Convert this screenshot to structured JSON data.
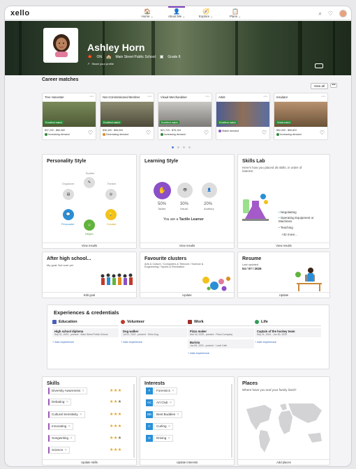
{
  "nav": {
    "logo": "xello",
    "items": [
      {
        "label": "Home",
        "icon": "house-icon"
      },
      {
        "label": "About Me",
        "icon": "person-icon"
      },
      {
        "label": "Explore",
        "icon": "compass-icon"
      },
      {
        "label": "Plans",
        "icon": "clipboard-icon"
      }
    ],
    "chevron": "⌄"
  },
  "profile": {
    "name": "Ashley Horn",
    "province": "ON",
    "school": "Main Street Public School",
    "grade": "Grade 8",
    "share_label": "Share your profile"
  },
  "career": {
    "title": "Career matches",
    "view_all": "View all",
    "more": "•••",
    "cards": [
      {
        "title": "Tree Harvester",
        "badge": "Excellent match",
        "salary": "$37,232 - $60,082",
        "demand": "Increasing demand",
        "demand_color": "#2f8a3a",
        "img": "#6b7d4b"
      },
      {
        "title": "Non-Commissioned Member",
        "badge": "Excellent match",
        "salary": "$36,300 - $96,000",
        "demand": "Decreasing demand",
        "demand_color": "#e08a1e",
        "img": "#6c6a55"
      },
      {
        "title": "Visual Merchandiser",
        "badge": "Excellent match",
        "salary": "$21,720 - $75,104",
        "demand": "Increasing demand",
        "demand_color": "#2f8a3a",
        "img": "#a8a7a5"
      },
      {
        "title": "Artist",
        "badge": "Excellent match",
        "salary": "",
        "demand": "Stable demand",
        "demand_color": "#8a55c8",
        "img": "#5a6ea3"
      },
      {
        "title": "Insulator",
        "badge": "Great match",
        "salary": "$52,000 - $90,822",
        "demand": "Increasing demand",
        "demand_color": "#2f8a3a",
        "img": "#9e7a59"
      }
    ]
  },
  "personality": {
    "title": "Personality Style",
    "traits": [
      "Builder",
      "Organizer",
      "Thinker",
      "Persuader",
      "Creator",
      "Helper"
    ],
    "footer": "View results"
  },
  "learning": {
    "title": "Learning Style",
    "styles": [
      {
        "pct": "50%",
        "name": "Tactile"
      },
      {
        "pct": "30%",
        "name": "Visual"
      },
      {
        "pct": "20%",
        "name": "Auditory"
      }
    ],
    "prefix": "You are a ",
    "result": "Tactile Learner",
    "footer": "View results"
  },
  "skills_lab": {
    "title": "Skills Lab",
    "subtitle": "Here's how you placed 35 skills, in order of interest:",
    "items": [
      "Negotiating",
      "Operating Equipment or Machines",
      "Teaching"
    ],
    "more": "+32 more...",
    "footer": "View results"
  },
  "after_hs": {
    "title": "After high school...",
    "subtitle": "My goal: Not sure yet",
    "footer": "Edit goal"
  },
  "clusters": {
    "title": "Favourite clusters",
    "text": "Arts & Culture  /  Computers & Telecom  /  Science & Engineering  /  Sports & Recreation",
    "footer": "Update"
  },
  "resume": {
    "title": "Resume",
    "last_label": "Last updated",
    "last_date": "04 / 07 / 2026",
    "footer": "Update"
  },
  "experiences": {
    "title": "Experiences & credentials",
    "columns": [
      {
        "name": "Education",
        "color": "#4b5fb8",
        "items": [
          {
            "a": "High school diploma",
            "b": "Sep 01, 2023 - present · Main Street Public School"
          }
        ],
        "add": "+ Add experience"
      },
      {
        "name": "Volunteer",
        "color": "#c0392b",
        "items": [
          {
            "a": "Dog walker",
            "b": "Jul 01, 2022 - present · Shiro Dog"
          }
        ],
        "add": "+ Add experience"
      },
      {
        "name": "Work",
        "color": "#a0302a",
        "items": [
          {
            "a": "Pizza maker",
            "b": "Mar 18, 2025 - present · Pizza Company"
          },
          {
            "a": "Barista",
            "b": "Jun 05, 2024 - present · Local Cafe"
          }
        ],
        "add": "+ Add experience"
      },
      {
        "name": "Life",
        "color": "#2f9e55",
        "items": [
          {
            "a": "Captain of the hockey team",
            "b": "Sep 01, 2024 - Jun 30, 2025"
          }
        ],
        "add": "+ Add experience"
      }
    ]
  },
  "skills": {
    "title": "Skills",
    "items": [
      {
        "name": "Diversity Awareness",
        "stars": 3
      },
      {
        "name": "Debating",
        "stars": 2
      },
      {
        "name": "Cultural Sensitivity",
        "stars": 3
      },
      {
        "name": "Innovating",
        "stars": 3
      },
      {
        "name": "Songwriting",
        "stars": 2
      },
      {
        "name": "Science",
        "stars": 3
      }
    ],
    "footer": "Update skills"
  },
  "interests": {
    "title": "Interests",
    "items": [
      {
        "code": "F",
        "name": "Forensics"
      },
      {
        "code": "AC",
        "name": "Art Club"
      },
      {
        "code": "BB",
        "name": "Best Buddies"
      },
      {
        "code": "C",
        "name": "Curling"
      },
      {
        "code": "D",
        "name": "Driving"
      }
    ],
    "footer": "Update interests"
  },
  "places": {
    "title": "Places",
    "subtitle": "Where have you and your family lived?",
    "footer": "Add places"
  }
}
